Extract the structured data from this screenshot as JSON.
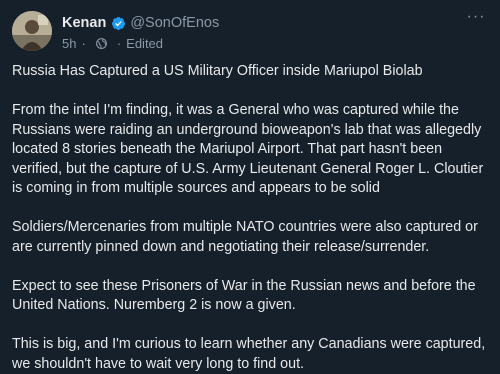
{
  "author": {
    "display_name": "Kenan",
    "handle": "@SonOfEnos",
    "verified_icon": "verified-badge-icon"
  },
  "meta": {
    "time": "5h",
    "separator": "·",
    "globe_icon": "globe-icon",
    "edited_label": "Edited"
  },
  "more_label": "···",
  "post": {
    "paragraphs": [
      "Russia Has Captured a US Military Officer inside Mariupol Biolab",
      "From the intel I'm finding, it was a General who was captured while the Russians were raiding an underground bioweapon's lab that was allegedly located 8 stories beneath the Mariupol Airport. That part hasn't been verified, but the capture of U.S. Army Lieutenant General Roger L. Cloutier is coming in from multiple sources and appears to be solid",
      "Soldiers/Mercenaries from multiple NATO countries were also captured or are currently pinned down and negotiating their release/surrender.",
      "Expect to see these Prisoners of War in the Russian news and before the United Nations. Nuremberg 2 is now a given.",
      "This is big, and I'm curious to learn whether any Canadians were captured, we shouldn't have to wait very long to find out."
    ]
  },
  "colors": {
    "background": "#15202b",
    "text": "#e7e9ea",
    "secondary": "#8b98a5",
    "verified": "#1d9bf0"
  }
}
